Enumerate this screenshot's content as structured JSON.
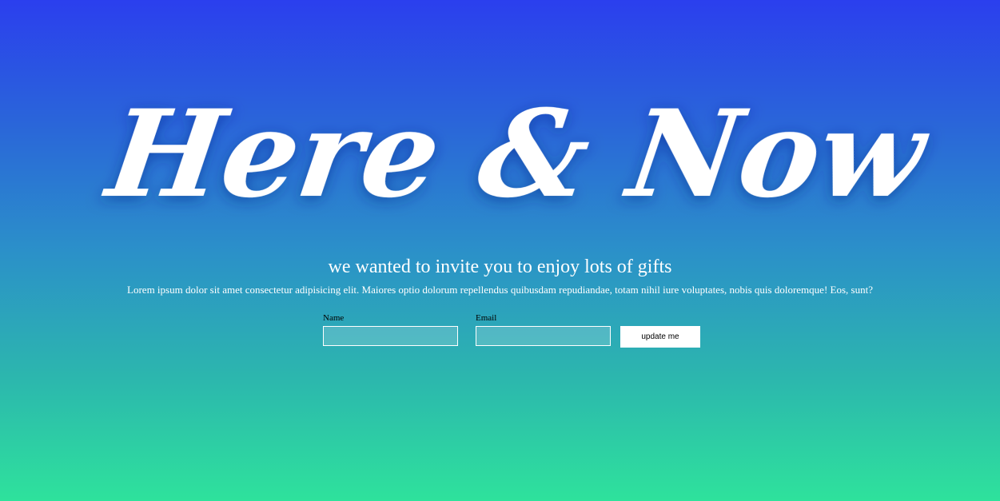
{
  "hero": {
    "title": "Here & Now",
    "tagline": "we wanted to invite you to enjoy lots of gifts",
    "description": "Lorem ipsum dolor sit amet consectetur adipisicing elit. Maiores optio dolorum repellendus quibusdam repudiandae, totam nihil iure voluptates, nobis quis doloremque! Eos, sunt?"
  },
  "form": {
    "name_label": "Name",
    "name_value": "",
    "email_label": "Email",
    "email_value": "",
    "submit_label": "update me"
  },
  "colors": {
    "gradient_top": "#2b3fee",
    "gradient_bottom": "#2ee29c",
    "text": "#ffffff"
  }
}
